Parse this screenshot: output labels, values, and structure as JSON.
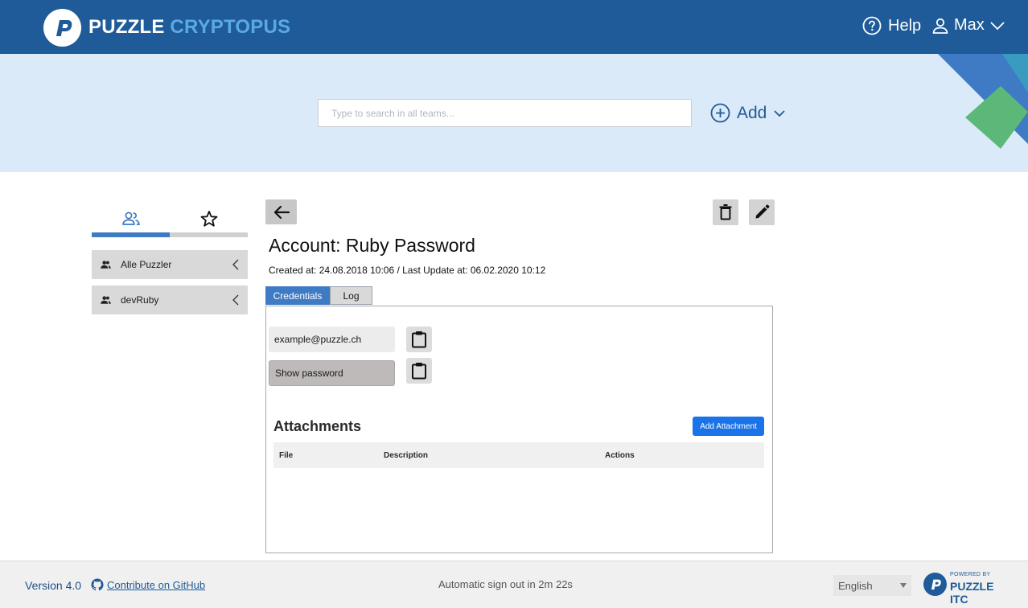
{
  "header": {
    "brand_part1": "PUZZLE",
    "brand_part2": "CRYPTOPUS",
    "help_label": "Help",
    "user_name": "Max"
  },
  "search": {
    "placeholder": "Type to search in all teams...",
    "add_label": "Add"
  },
  "sidebar": {
    "tabs": [
      {
        "icon": "teams-icon"
      },
      {
        "icon": "star-icon"
      }
    ],
    "teams": [
      {
        "label": "Alle Puzzler"
      },
      {
        "label": "devRuby"
      }
    ]
  },
  "account": {
    "title": "Account: Ruby Password",
    "meta": "Created at: 24.08.2018 10:06 / Last Update at: 06.02.2020 10:12",
    "tabs": [
      {
        "label": "Credentials",
        "active": true
      },
      {
        "label": "Log",
        "active": false
      }
    ],
    "username": "example@puzzle.ch",
    "show_password": "Show password",
    "attachments_title": "Attachments",
    "add_attachment": "Add Attachment",
    "table_headers": [
      "File",
      "Description",
      "Actions"
    ]
  },
  "footer": {
    "version": "Version 4.0",
    "github": "Contribute on GitHub",
    "signout": "Automatic sign out in 2m 22s",
    "language": "English",
    "powered_small": "POWERED BY",
    "powered_big": "PUZZLE ITC"
  },
  "colors": {
    "header_bg": "#1e5b98",
    "band_bg": "#dbeaf8",
    "accent": "#3e7bc4",
    "attachment_button": "#1a73e8"
  }
}
